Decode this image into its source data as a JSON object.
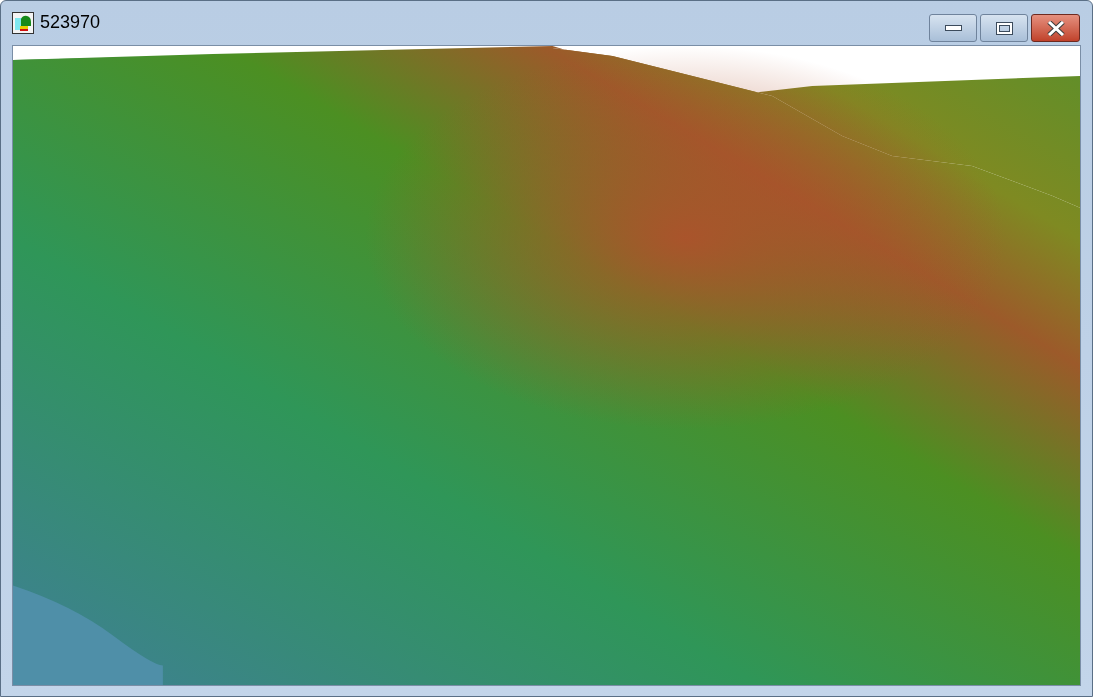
{
  "window": {
    "title": "523970"
  }
}
